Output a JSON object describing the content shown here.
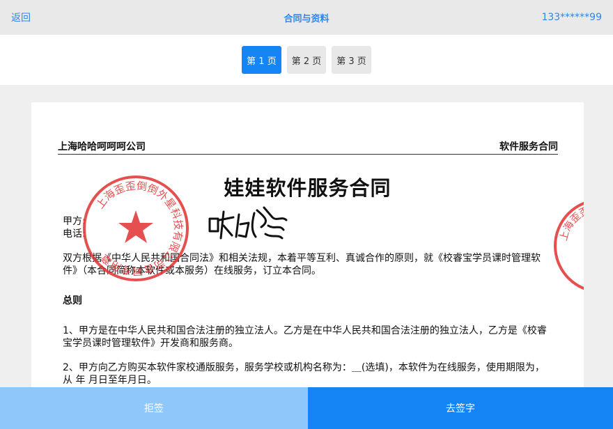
{
  "topbar": {
    "back_label": "返回",
    "title": "合同与资料",
    "phone": "133******99"
  },
  "pager": {
    "pages": [
      "第 1 页",
      "第 2 页",
      "第 3 页"
    ],
    "current": 1
  },
  "document": {
    "company": "上海哈哈呵呵呵公司",
    "doc_type": "软件服务合同",
    "title": "娃娃软件服务合同",
    "party_a_label": "甲方:",
    "phone_label": "电话:",
    "intro": "双方根据《中华人民共和国合同法》和相关法规，本着平等互利、真诚合作的原则，就《校睿宝学员课时管理软件》（本合同简称本软件或本服务）在线服务，订立本合同。",
    "section_title": "总则",
    "item1": "1、甲方是在中华人民共和国合法注册的独立法人。乙方是在中华人民共和国合法注册的独立法人，乙方是《校睿宝学员课时管理软件》开发商和服务商。",
    "item2": "2、甲方向乙方购买本软件家校通版服务，服务学校或机构名称为：＿(选填)，本软件为在线服务，使用期限为，从  年  月日至年月日。",
    "stamp_text": "上海歪歪倒倒外星科技有限公司合同专用章",
    "stamp_text_2": "上海歪歪倒倒外星科技有限公司",
    "signature_text": "哈哈哈",
    "stamp_color": "#e23030"
  },
  "actions": {
    "reject_label": "拒签",
    "sign_label": "去签字"
  }
}
